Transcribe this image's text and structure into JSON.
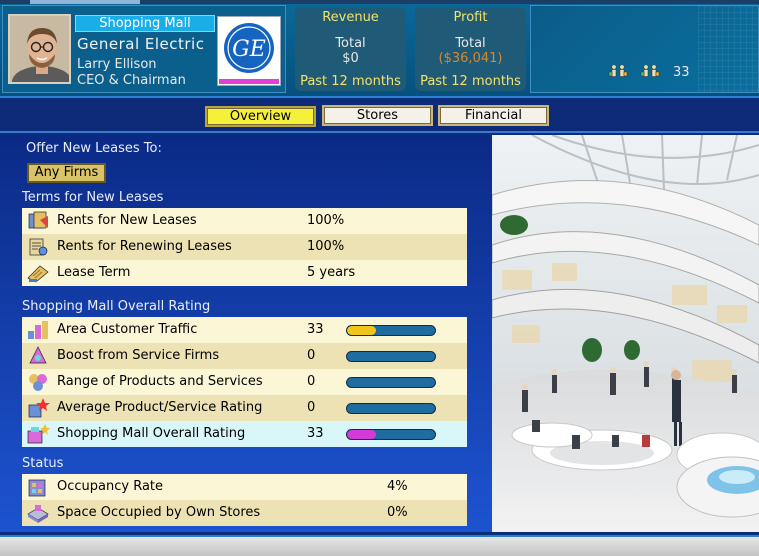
{
  "header": {
    "mall_type": "Shopping Mall",
    "company_name": "General Electric",
    "person_name": "Larry Ellison",
    "person_title": "CEO & Chairman",
    "logo_text": "GE",
    "revenue": {
      "label": "Revenue",
      "total_label": "Total",
      "value": "$0",
      "period": "Past 12 months"
    },
    "profit": {
      "label": "Profit",
      "total_label": "Total",
      "value": "($36,041)",
      "period": "Past 12 months"
    },
    "visitor_count": "33"
  },
  "tabs": [
    {
      "label": "Overview",
      "active": true
    },
    {
      "label": "Stores",
      "active": false
    },
    {
      "label": "Financial",
      "active": false
    }
  ],
  "offer": {
    "label": "Offer New Leases To:",
    "button_label": "Any Firms"
  },
  "terms": {
    "title": "Terms for New Leases",
    "rows": [
      {
        "name": "Rents for New Leases",
        "value": "100%",
        "icon": "rent-icon"
      },
      {
        "name": "Rents for Renewing Leases",
        "value": "100%",
        "icon": "renewal-icon"
      },
      {
        "name": "Lease Term",
        "value": "5 years",
        "icon": "lease-term-icon"
      }
    ]
  },
  "rating": {
    "title": "Shopping Mall Overall Rating",
    "rows": [
      {
        "name": "Area Customer Traffic",
        "value": "33",
        "level": 0.33,
        "fill_color": "#f2c51a",
        "icon": "traffic-icon"
      },
      {
        "name": "Boost from Service Firms",
        "value": "0",
        "level": 0,
        "fill_color": "#f2c51a",
        "icon": "service-icon"
      },
      {
        "name": "Range of Products and Services",
        "value": "0",
        "level": 0,
        "fill_color": "#f2c51a",
        "icon": "range-icon"
      },
      {
        "name": "Average Product/Service Rating",
        "value": "0",
        "level": 0,
        "fill_color": "#f2c51a",
        "icon": "star-rating-icon"
      },
      {
        "name": "Shopping Mall Overall Rating",
        "value": "33",
        "level": 0.33,
        "fill_color": "#d43ad6",
        "icon": "mall-rating-icon"
      }
    ]
  },
  "status": {
    "title": "Status",
    "rows": [
      {
        "name": "Occupancy Rate",
        "value": "4%",
        "icon": "occupancy-icon"
      },
      {
        "name": "Space Occupied by Own Stores",
        "value": "0%",
        "icon": "own-space-icon"
      }
    ]
  },
  "colors": {
    "accent_yellow": "#f5f03a",
    "header_bg": "#0b5f8c",
    "content_bg": "#1d53d0",
    "negative_value": "#d8892e"
  }
}
